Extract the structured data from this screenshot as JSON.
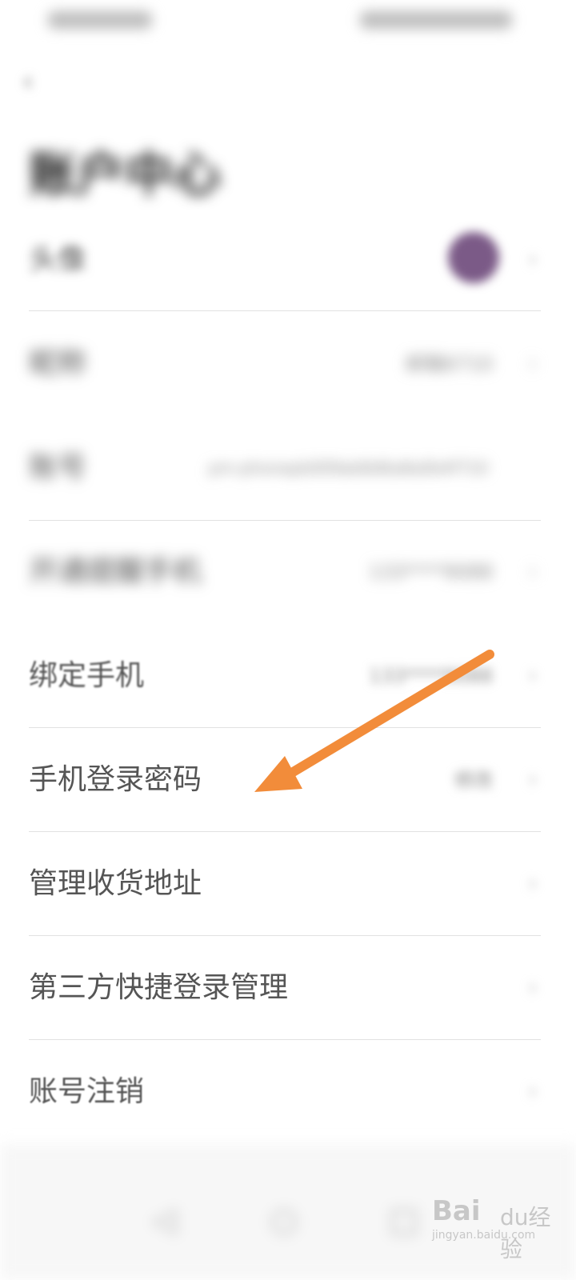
{
  "title": "账户中心",
  "rows": [
    {
      "label": "头像",
      "value": ""
    },
    {
      "label": "昵称",
      "value": "邮箱6710"
    },
    {
      "label": "账号",
      "value": "pm-phonepb009ab8d6a8a0b4f710"
    },
    {
      "label": "开通提醒手机",
      "value": "133****9088"
    },
    {
      "label": "绑定手机",
      "value": "133****9088"
    },
    {
      "label": "手机登录密码",
      "value": "修改"
    },
    {
      "label": "管理收货地址",
      "value": ""
    },
    {
      "label": "第三方快捷登录管理",
      "value": ""
    },
    {
      "label": "账号注销",
      "value": ""
    }
  ],
  "icons": {
    "back": "chevron-left-icon",
    "chevron": "chevron-right-icon",
    "nav_back": "triangle-back-icon",
    "nav_home": "circle-home-icon",
    "nav_recent": "square-recent-icon"
  },
  "watermark": {
    "logo_left": "Bai",
    "logo_right": "du经验",
    "url": "jingyan.baidu.com"
  },
  "colors": {
    "arrow": "#f28c3a",
    "avatar": "#7b5a87"
  }
}
